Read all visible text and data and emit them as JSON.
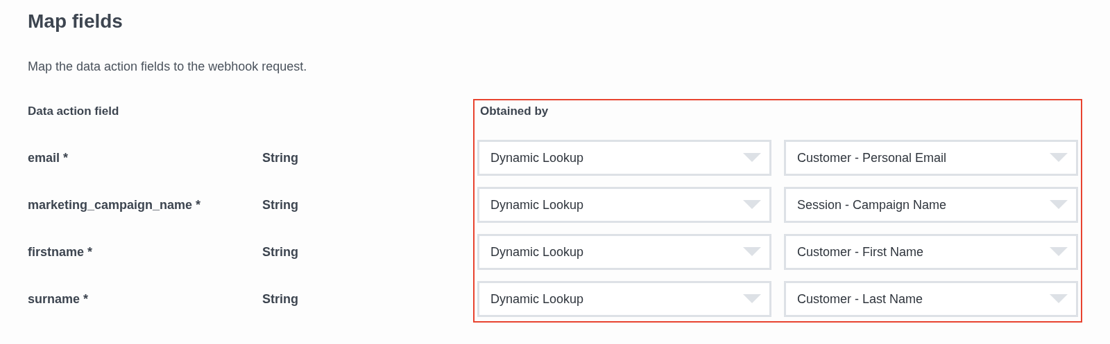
{
  "title": "Map fields",
  "description": "Map the data action fields to the webhook request.",
  "columns": {
    "field": "Data action field",
    "obtained_by": "Obtained by"
  },
  "rows": [
    {
      "field": "email *",
      "type": "String",
      "source": "Dynamic Lookup",
      "value": "Customer - Personal Email"
    },
    {
      "field": "marketing_campaign_name *",
      "type": "String",
      "source": "Dynamic Lookup",
      "value": "Session - Campaign Name"
    },
    {
      "field": "firstname *",
      "type": "String",
      "source": "Dynamic Lookup",
      "value": "Customer - First Name"
    },
    {
      "field": "surname *",
      "type": "String",
      "source": "Dynamic Lookup",
      "value": "Customer - Last Name"
    }
  ]
}
